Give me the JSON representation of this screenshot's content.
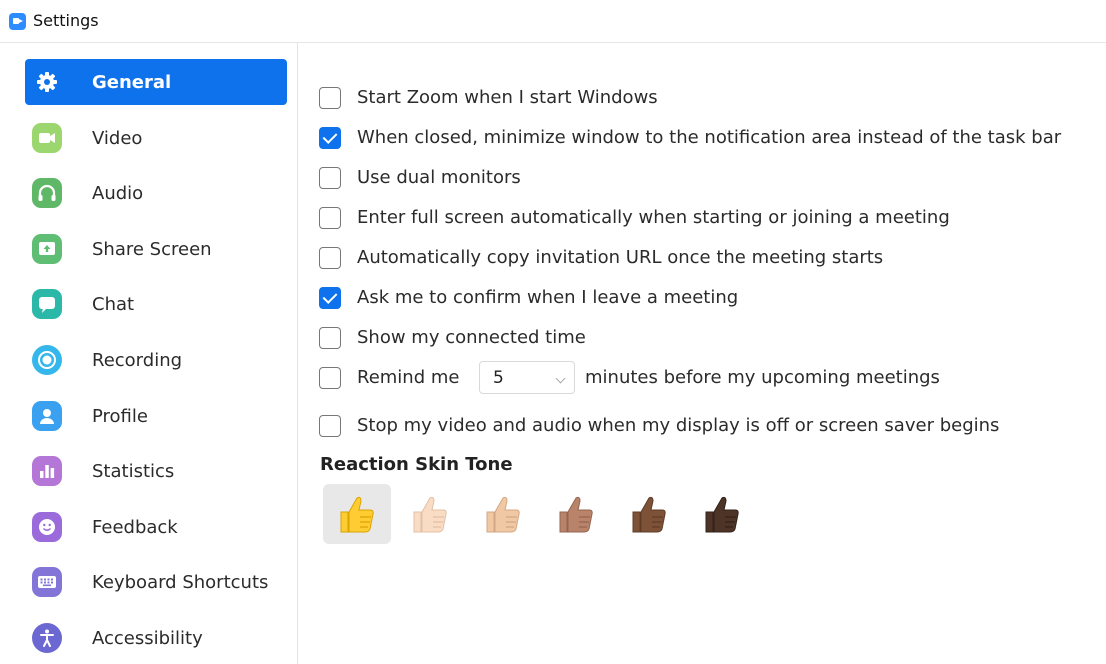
{
  "window": {
    "title": "Settings"
  },
  "sidebar": {
    "items": [
      {
        "label": "General",
        "icon": "gear-icon",
        "active": true,
        "color": "#0E72ED"
      },
      {
        "label": "Video",
        "icon": "video-camera-icon",
        "color": "#9BD66E"
      },
      {
        "label": "Audio",
        "icon": "headphones-icon",
        "color": "#5FB868"
      },
      {
        "label": "Share Screen",
        "icon": "share-screen-icon",
        "color": "#5FBE74"
      },
      {
        "label": "Chat",
        "icon": "chat-bubble-icon",
        "color": "#2CB8A8"
      },
      {
        "label": "Recording",
        "icon": "record-icon",
        "color": "#36B7EC"
      },
      {
        "label": "Profile",
        "icon": "profile-icon",
        "color": "#3AA0F0"
      },
      {
        "label": "Statistics",
        "icon": "statistics-icon",
        "color": "#B477D8"
      },
      {
        "label": "Feedback",
        "icon": "feedback-icon",
        "color": "#9B6ADB"
      },
      {
        "label": "Keyboard Shortcuts",
        "icon": "keyboard-icon",
        "color": "#8375D8"
      },
      {
        "label": "Accessibility",
        "icon": "accessibility-icon",
        "color": "#6C68D2"
      }
    ]
  },
  "general": {
    "options": [
      {
        "label": "Start Zoom when I start Windows",
        "checked": false
      },
      {
        "label": "When closed, minimize window to the notification area instead of the task bar",
        "checked": true
      },
      {
        "label": "Use dual monitors",
        "checked": false
      },
      {
        "label": "Enter full screen automatically when starting or joining a meeting",
        "checked": false
      },
      {
        "label": "Automatically copy invitation URL once the meeting starts",
        "checked": false
      },
      {
        "label": "Ask me to confirm when I leave a meeting",
        "checked": true
      },
      {
        "label": "Show my connected time",
        "checked": false
      }
    ],
    "remind": {
      "label_before": "Remind me",
      "value": "5",
      "label_after": "minutes before my upcoming meetings",
      "checked": false
    },
    "stop_video": {
      "label": "Stop my video and audio when my display is off or screen saver begins",
      "checked": false
    },
    "reaction": {
      "heading": "Reaction Skin Tone",
      "tones": [
        "#FFCC33",
        "#F9DCC4",
        "#F0C8A4",
        "#B9836A",
        "#7E5237",
        "#4D3426"
      ],
      "selected": 0
    }
  },
  "colors": {
    "accent": "#0E72ED"
  }
}
